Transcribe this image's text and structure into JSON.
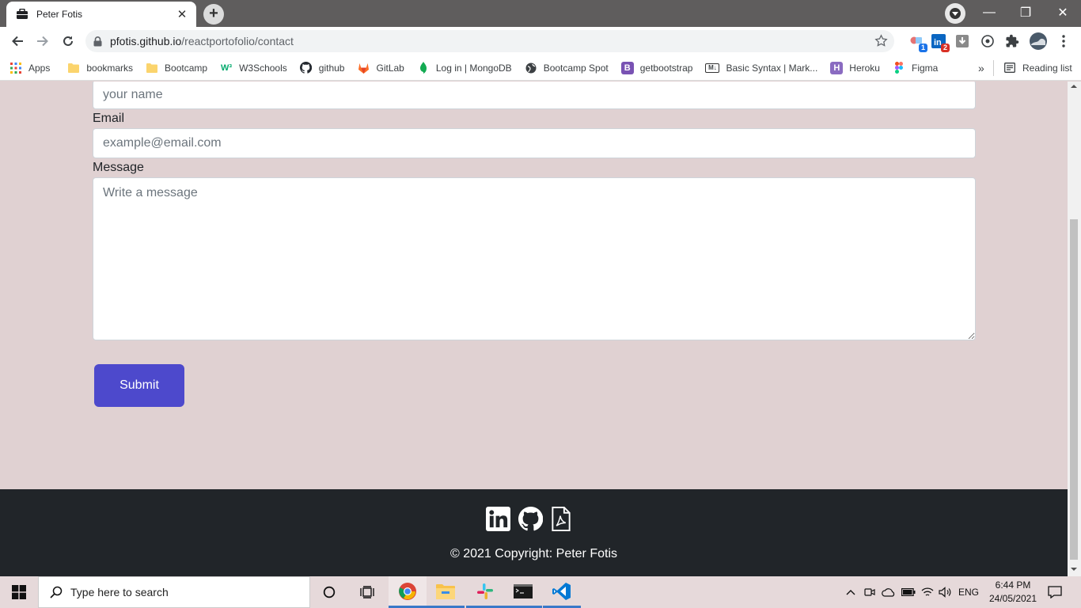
{
  "browser": {
    "tab_title": "Peter Fotis",
    "tab_close": "✕",
    "new_tab": "+",
    "window_controls": [
      "—",
      "❐",
      "✕"
    ],
    "url_host": "pfotis.github.io",
    "url_path": "/reactportofolio/contact",
    "extensions": [
      {
        "icon": "extension-icon",
        "badge": "1",
        "badge_color": "#1a73e8"
      },
      {
        "icon": "linkedin-ext-icon",
        "badge": "2",
        "badge_color": "#d93025"
      },
      {
        "icon": "download-icon"
      },
      {
        "icon": "extension-circle-icon"
      },
      {
        "icon": "puzzle-icon"
      },
      {
        "icon": "profile-avatar-icon"
      },
      {
        "icon": "menu-dots-icon"
      }
    ]
  },
  "bookmarks": {
    "items": [
      {
        "label": "Apps",
        "icon": "apps-grid-icon"
      },
      {
        "label": "bookmarks",
        "icon": "folder-icon"
      },
      {
        "label": "Bootcamp",
        "icon": "folder-icon"
      },
      {
        "label": "W3Schools",
        "icon": "w3schools-icon",
        "glyph": "W³"
      },
      {
        "label": "github",
        "icon": "github-icon"
      },
      {
        "label": "GitLab",
        "icon": "gitlab-icon"
      },
      {
        "label": "Log in | MongoDB",
        "icon": "mongodb-icon"
      },
      {
        "label": "Bootcamp Spot",
        "icon": "globe-icon"
      },
      {
        "label": "getbootstrap",
        "icon": "bootstrap-icon",
        "glyph": "B"
      },
      {
        "label": "Basic Syntax | Mark...",
        "icon": "markdown-icon",
        "glyph": "M↓"
      },
      {
        "label": "Heroku",
        "icon": "heroku-icon",
        "glyph": "H"
      },
      {
        "label": "Figma",
        "icon": "figma-icon"
      }
    ],
    "overflow": "»",
    "reading_list": "Reading list"
  },
  "contact_form": {
    "name_placeholder": "your name",
    "email_label": "Email",
    "email_placeholder": "example@email.com",
    "message_label": "Message",
    "message_placeholder": "Write a message",
    "submit_label": "Submit"
  },
  "footer": {
    "social_icons": [
      "linkedin-icon",
      "github-icon",
      "pdf-resume-icon"
    ],
    "copyright": "© 2021 Copyright: Peter Fotis"
  },
  "taskbar": {
    "search_placeholder": "Type here to search",
    "language": "ENG",
    "time": "6:44 PM",
    "date": "24/05/2021"
  },
  "colors": {
    "page_bg": "#e0d1d2",
    "submit_bg": "#4d49cc",
    "footer_bg": "#212529",
    "tabstrip_bg": "#5f5d5d"
  }
}
